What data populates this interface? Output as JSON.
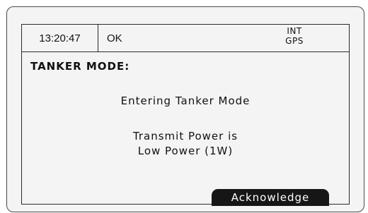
{
  "status": {
    "time": "13:20:47",
    "message": "OK",
    "source_line1": "INT",
    "source_line2": "GPS"
  },
  "screen": {
    "title": "TANKER MODE:",
    "line1": "Entering Tanker Mode",
    "line2": "Transmit Power is",
    "line3": "Low Power (1W)"
  },
  "softkeys": {
    "acknowledge": "Acknowledge"
  }
}
